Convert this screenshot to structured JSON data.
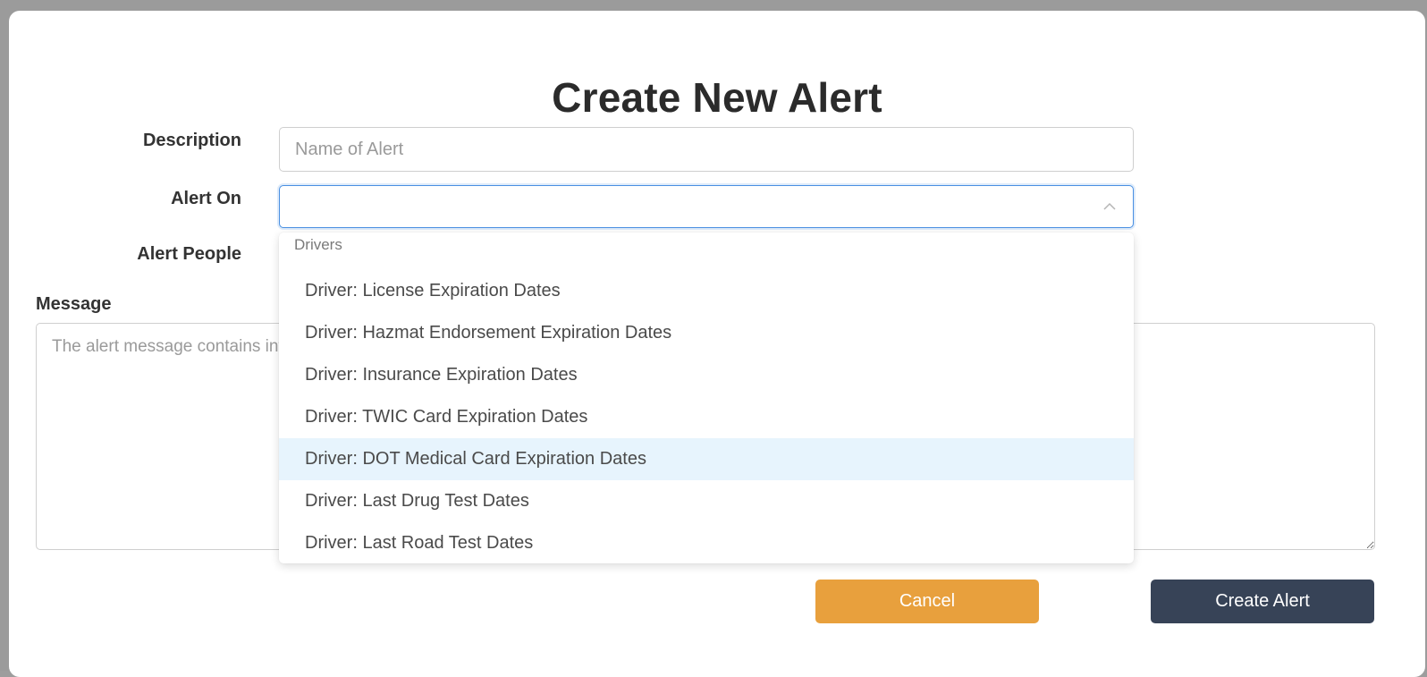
{
  "modal": {
    "title": "Create New Alert",
    "labels": {
      "description": "Description",
      "alert_on": "Alert On",
      "alert_people": "Alert People",
      "message": "Message"
    },
    "description_input": {
      "value": "",
      "placeholder": "Name of Alert"
    },
    "alert_on_select": {
      "value": "",
      "open": true,
      "chevron_icon": "chevron-up-icon"
    },
    "message_textarea": {
      "placeholder": "The alert message contains information about the item, you may add any additional notes to go along with the alert, or leave blank."
    },
    "dropdown": {
      "group": "Drivers",
      "options": [
        {
          "label": "Driver: License Expiration Dates",
          "highlighted": false
        },
        {
          "label": "Driver: Hazmat Endorsement Expiration Dates",
          "highlighted": false
        },
        {
          "label": "Driver: Insurance Expiration Dates",
          "highlighted": false
        },
        {
          "label": "Driver: TWIC Card Expiration Dates",
          "highlighted": false
        },
        {
          "label": "Driver: DOT Medical Card Expiration Dates",
          "highlighted": true
        },
        {
          "label": "Driver: Last Drug Test Dates",
          "highlighted": false
        },
        {
          "label": "Driver: Last Road Test Dates",
          "highlighted": false
        }
      ]
    },
    "buttons": {
      "cancel": "Cancel",
      "create": "Create Alert"
    },
    "colors": {
      "cancel_bg": "#e8a03d",
      "create_bg": "#374357",
      "focus_border": "#4a90e2",
      "highlight_bg": "#e7f4fd"
    }
  }
}
